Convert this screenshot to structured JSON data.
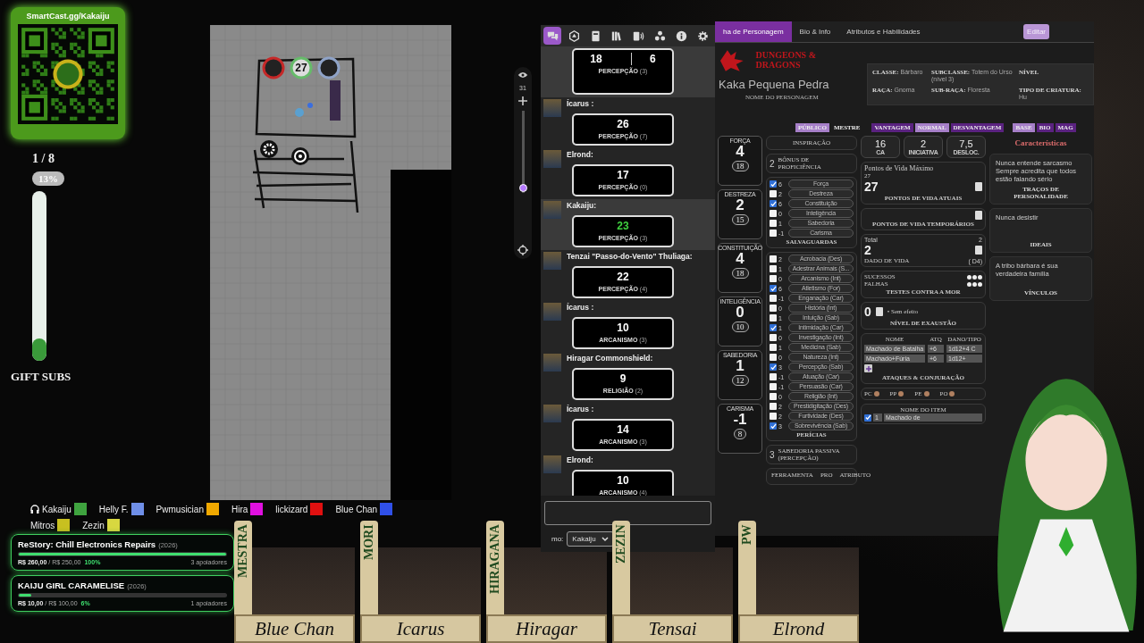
{
  "qr_card": {
    "title": "SmartCast.gg/Kakaiju"
  },
  "gift_subs": {
    "count": "1 / 8",
    "percent": "13%",
    "level": 0.13,
    "label": "GIFT SUBS"
  },
  "map": {
    "tokens": [
      {
        "color": "#c62828"
      },
      {
        "label": "27",
        "color": "#66bb6a"
      },
      {
        "color": "#8fa3c7"
      }
    ]
  },
  "map_toolbar": {
    "zoom": "31",
    "level": 0.05
  },
  "chat": {
    "tabs": [
      {
        "kind": "chat",
        "selected": true
      },
      {
        "kind": "dice",
        "selected": false
      },
      {
        "kind": "journal",
        "selected": false
      },
      {
        "kind": "compendium",
        "selected": false
      },
      {
        "kind": "jukebox",
        "selected": false
      },
      {
        "kind": "cards",
        "selected": false
      },
      {
        "kind": "info",
        "selected": false
      },
      {
        "kind": "settings",
        "selected": false
      }
    ],
    "rolls": [
      {
        "results": [
          "18",
          "6"
        ],
        "skill": "**PERCEPÇÃO** (3)",
        "highlighted": true,
        "critical": false
      },
      {
        "speaker": "Ícarus :",
        "results": [
          "26"
        ],
        "skill": "**PERCEPÇÃO** (7)",
        "highlighted": false,
        "critical": false
      },
      {
        "speaker": "Elrond:",
        "results": [
          "17"
        ],
        "skill": "**PERCEPÇÃO** (0)",
        "highlighted": false,
        "critical": false
      },
      {
        "speaker": "Kakaiju:",
        "results": [
          "23"
        ],
        "skill": "**PERCEPÇÃO** (3)",
        "highlighted": true,
        "critical": true
      },
      {
        "speaker": "Tenzai \"Passo-do-Vento\" Thuliaga:",
        "results": [
          "22"
        ],
        "skill": "**PERCEPÇÃO** (4)",
        "highlighted": false,
        "critical": false
      },
      {
        "speaker": "Ícarus :",
        "results": [
          "10"
        ],
        "skill": "**ARCANISMO** (3)",
        "highlighted": false,
        "critical": false
      },
      {
        "speaker": "Hiragar Commonshield:",
        "results": [
          "9"
        ],
        "skill": "**RELIGIÃO** (2)",
        "highlighted": false,
        "critical": false
      },
      {
        "speaker": "Ícarus :",
        "results": [
          "14"
        ],
        "skill": "**ARCANISMO** (3)",
        "highlighted": false,
        "critical": false
      },
      {
        "speaker": "Elrond:",
        "results": [
          "10"
        ],
        "skill": "**ARCANISMO** (4)",
        "highlighted": false,
        "critical": false
      }
    ],
    "speaking_as": {
      "label": "mo:",
      "value": "Kakaiju"
    }
  },
  "sheet": {
    "tabs": [
      {
        "label": "ha de Personagem",
        "selected": true
      },
      {
        "label": "Bio & Info",
        "selected": false
      },
      {
        "label": "Atributos e Habilidades",
        "selected": false
      }
    ],
    "edit_button": "Editar",
    "logo": "DUNGEONS & DRAGONS",
    "character_name": "Kaka Pequena Pedra",
    "name_label": "NOME DO PERSONAGEM",
    "info": [
      {
        "label": "CLASSE:",
        "value": "Bárbaro"
      },
      {
        "label": "SUBCLASSE:",
        "value": "Totem do Urso (nível 3)"
      },
      {
        "label": "NÍVEL"
      },
      {
        "label": "RAÇA:",
        "value": "Gnoma"
      },
      {
        "label": "SUB-RAÇA:",
        "value": "Floresta"
      },
      {
        "label": "TIPO DE CRIATURA:",
        "value": "Hu"
      }
    ],
    "toggle_groups": [
      [
        {
          "label": "PÚBLICO",
          "selected": true
        },
        {
          "label": "MESTRE",
          "selected": false
        }
      ],
      [
        {
          "label": "VANTAGEM",
          "selected": false
        },
        {
          "label": "NORMAL",
          "selected": true
        },
        {
          "label": "DESVANTAGEM",
          "selected": false
        }
      ],
      [
        {
          "label": "BASE",
          "selected": true
        },
        {
          "label": "BIO",
          "selected": false
        },
        {
          "label": "MAG",
          "selected": false
        }
      ]
    ],
    "abilities": [
      {
        "name": "FORÇA",
        "score": "4",
        "value": "18"
      },
      {
        "name": "DESTREZA",
        "score": "2",
        "value": "15"
      },
      {
        "name": "CONSTITUIÇÃO",
        "score": "4",
        "value": "18"
      },
      {
        "name": "INTELIGÊNCIA",
        "score": "0",
        "value": "10"
      },
      {
        "name": "SABEDORIA",
        "score": "1",
        "value": "12"
      },
      {
        "name": "CARISMA",
        "score": "-1",
        "value": "8"
      }
    ],
    "inspiration": "INSPIRAÇÃO",
    "proficiency": {
      "value": "2",
      "label": "BÔNUS DE PROFICIÊNCIA"
    },
    "saves": {
      "label": "SALVAGUARDAS",
      "items": [
        {
          "value": "6",
          "name": "Força",
          "checked": true
        },
        {
          "value": "2",
          "name": "Destreza",
          "checked": false
        },
        {
          "value": "6",
          "name": "Constituição",
          "checked": true
        },
        {
          "value": "0",
          "name": "Inteligência",
          "checked": false
        },
        {
          "value": "1",
          "name": "Sabedoria",
          "checked": false
        },
        {
          "value": "-1",
          "name": "Carisma",
          "checked": false
        }
      ]
    },
    "skills": {
      "label": "PERÍCIAS",
      "items": [
        {
          "value": "2",
          "name": "Acrobacia (Des)",
          "checked": false
        },
        {
          "value": "1",
          "name": "Adestrar Animais (S...",
          "checked": false
        },
        {
          "value": "0",
          "name": "Arcanismo (Int)",
          "checked": false
        },
        {
          "value": "6",
          "name": "Atletismo (For)",
          "checked": true
        },
        {
          "value": "-1",
          "name": "Enganação (Car)",
          "checked": false
        },
        {
          "value": "0",
          "name": "História (Int)",
          "checked": false
        },
        {
          "value": "1",
          "name": "Intuição (Sab)",
          "checked": false
        },
        {
          "value": "1",
          "name": "Intimidação (Car)",
          "checked": true
        },
        {
          "value": "0",
          "name": "Investigação (Int)",
          "checked": false
        },
        {
          "value": "1",
          "name": "Medicina (Sab)",
          "checked": false
        },
        {
          "value": "0",
          "name": "Natureza (Int)",
          "checked": false
        },
        {
          "value": "3",
          "name": "Percepção (Sab)",
          "checked": true
        },
        {
          "value": "-1",
          "name": "Atuação (Car)",
          "checked": false
        },
        {
          "value": "-1",
          "name": "Persuasão (Car)",
          "checked": false
        },
        {
          "value": "0",
          "name": "Religião (Int)",
          "checked": false
        },
        {
          "value": "2",
          "name": "Prestidigitação (Des)",
          "checked": false
        },
        {
          "value": "2",
          "name": "Furtividade (Des)",
          "checked": false
        },
        {
          "value": "3",
          "name": "Sobrevivência (Sab)",
          "checked": true
        }
      ]
    },
    "passive": {
      "value": "3",
      "label": "SABEDORIA PASSIVA (PERCEPÇÃO)"
    },
    "tools": {
      "columns": [
        "FERRAMENTA",
        "PRO",
        "ATRIBUTO"
      ]
    },
    "combat": [
      {
        "value": "16",
        "label": "CA"
      },
      {
        "value": "2",
        "label": "INICIATIVA"
      },
      {
        "value": "7,5",
        "label": "DESLOC."
      }
    ],
    "hp": {
      "max_label": "Pontos de Vida Máximo",
      "max": "27",
      "current": "27",
      "current_label": "PONTOS DE VIDA ATUAIS",
      "temp_label": "PONTOS DE VIDA TEMPORÁRIOS"
    },
    "hit_dice": {
      "total_label": "Total",
      "total": "2",
      "value": "2",
      "label": "DADO DE VIDA",
      "die": "( D4)"
    },
    "death_saves": {
      "successes_label": "SUCESSOS",
      "failures_label": "FALHAS",
      "label": "TESTES CONTRA A MOR"
    },
    "exhaustion": {
      "value": "0",
      "note": "• Sem efeito",
      "label": "NÍVEL DE EXAUSTÃO"
    },
    "attacks": {
      "columns": [
        "NOME",
        "ATQ",
        "DANO/TIPO"
      ],
      "rows": [
        [
          "Machado de Batalha",
          "+6",
          "1d12+4 C"
        ],
        [
          "Machado+Fúria",
          "+6",
          "1d12+"
        ]
      ],
      "label": "ATAQUES & CONJURAÇÃO"
    },
    "coins": [
      "PC",
      "PP",
      "PE",
      "PO"
    ],
    "inventory": {
      "column": "NOME DO ITEM",
      "rows": [
        {
          "qty": "1",
          "name": "Machado de",
          "checked": true
        }
      ]
    },
    "traits": {
      "title": "Características",
      "items": [
        {
          "text": "Nunca entende sarcasmo Sempre acredita que todos estão falando sério",
          "label": "TRAÇOS DE PERSONALIDADE"
        },
        {
          "text": "Nunca desistir",
          "label": "IDEAIS"
        },
        {
          "text": "A tribo bárbara é sua verdadeira família",
          "label": "VÍNCULOS"
        }
      ]
    }
  },
  "voice": [
    {
      "name": "Kakaiju",
      "color": "#3fa33f",
      "kind": "self"
    },
    {
      "name": "Helly F.",
      "color": "#6f8fe8",
      "kind": "user"
    },
    {
      "name": "Pwmusician",
      "color": "#f0a800",
      "kind": "user"
    },
    {
      "name": "Hira",
      "color": "#e010e0",
      "kind": "user"
    },
    {
      "name": "lickizard",
      "color": "#e01010",
      "kind": "user"
    },
    {
      "name": "Blue Chan",
      "color": "#3050e8",
      "kind": "user"
    },
    {
      "name": "Mitros",
      "color": "#c8c020",
      "kind": "user"
    },
    {
      "name": "Zezin",
      "color": "#d8d840",
      "kind": "user"
    }
  ],
  "goals": [
    {
      "title": "ReStory: Chill Electronics Repairs",
      "year": "(2026)",
      "amount": "**R$ 260,00** / R$ 250,00",
      "percent": "100%",
      "level": 1,
      "backers": "3 apoiadores"
    },
    {
      "title": "KAIJU GIRL CARAMELISE",
      "year": "(2026)",
      "amount": "**R$ 10,00** / R$ 100,00",
      "percent": "6%",
      "level": 0.06,
      "backers": "1 apoiadores"
    }
  ],
  "portraits": [
    {
      "name": "Blue Chan",
      "tag": "MESTRA"
    },
    {
      "name": "Icarus",
      "tag": "MORI"
    },
    {
      "name": "Hiragar",
      "tag": "HIRAGANA"
    },
    {
      "name": "Tensai",
      "tag": "ZEZIN"
    },
    {
      "name": "Elrond",
      "tag": "PW"
    }
  ]
}
